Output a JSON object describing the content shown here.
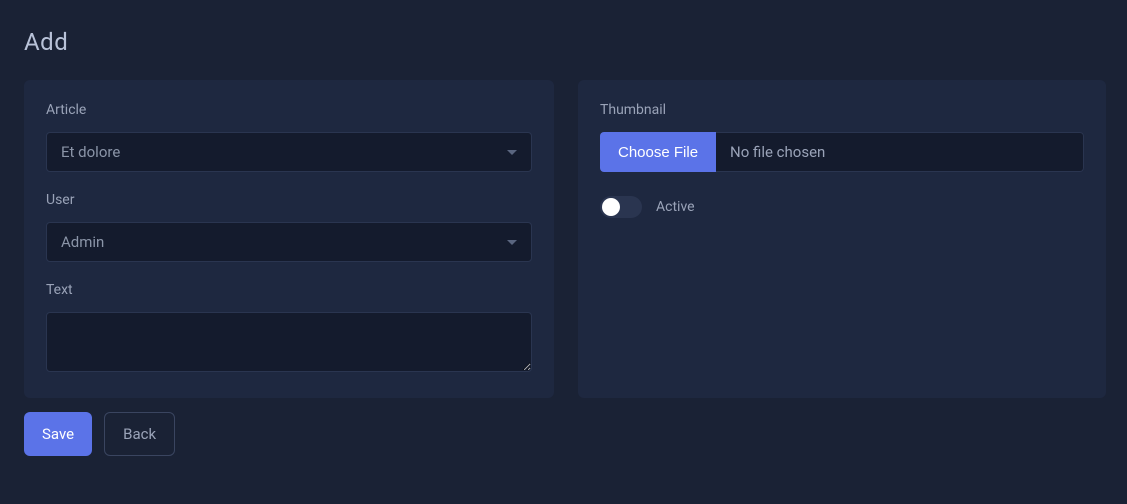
{
  "page": {
    "title": "Add"
  },
  "form": {
    "article": {
      "label": "Article",
      "value": "Et dolore"
    },
    "user": {
      "label": "User",
      "value": "Admin"
    },
    "text": {
      "label": "Text",
      "value": ""
    },
    "thumbnail": {
      "label": "Thumbnail",
      "button": "Choose File",
      "filename": "No file chosen"
    },
    "active": {
      "label": "Active",
      "value": false
    }
  },
  "buttons": {
    "save": "Save",
    "back": "Back"
  }
}
